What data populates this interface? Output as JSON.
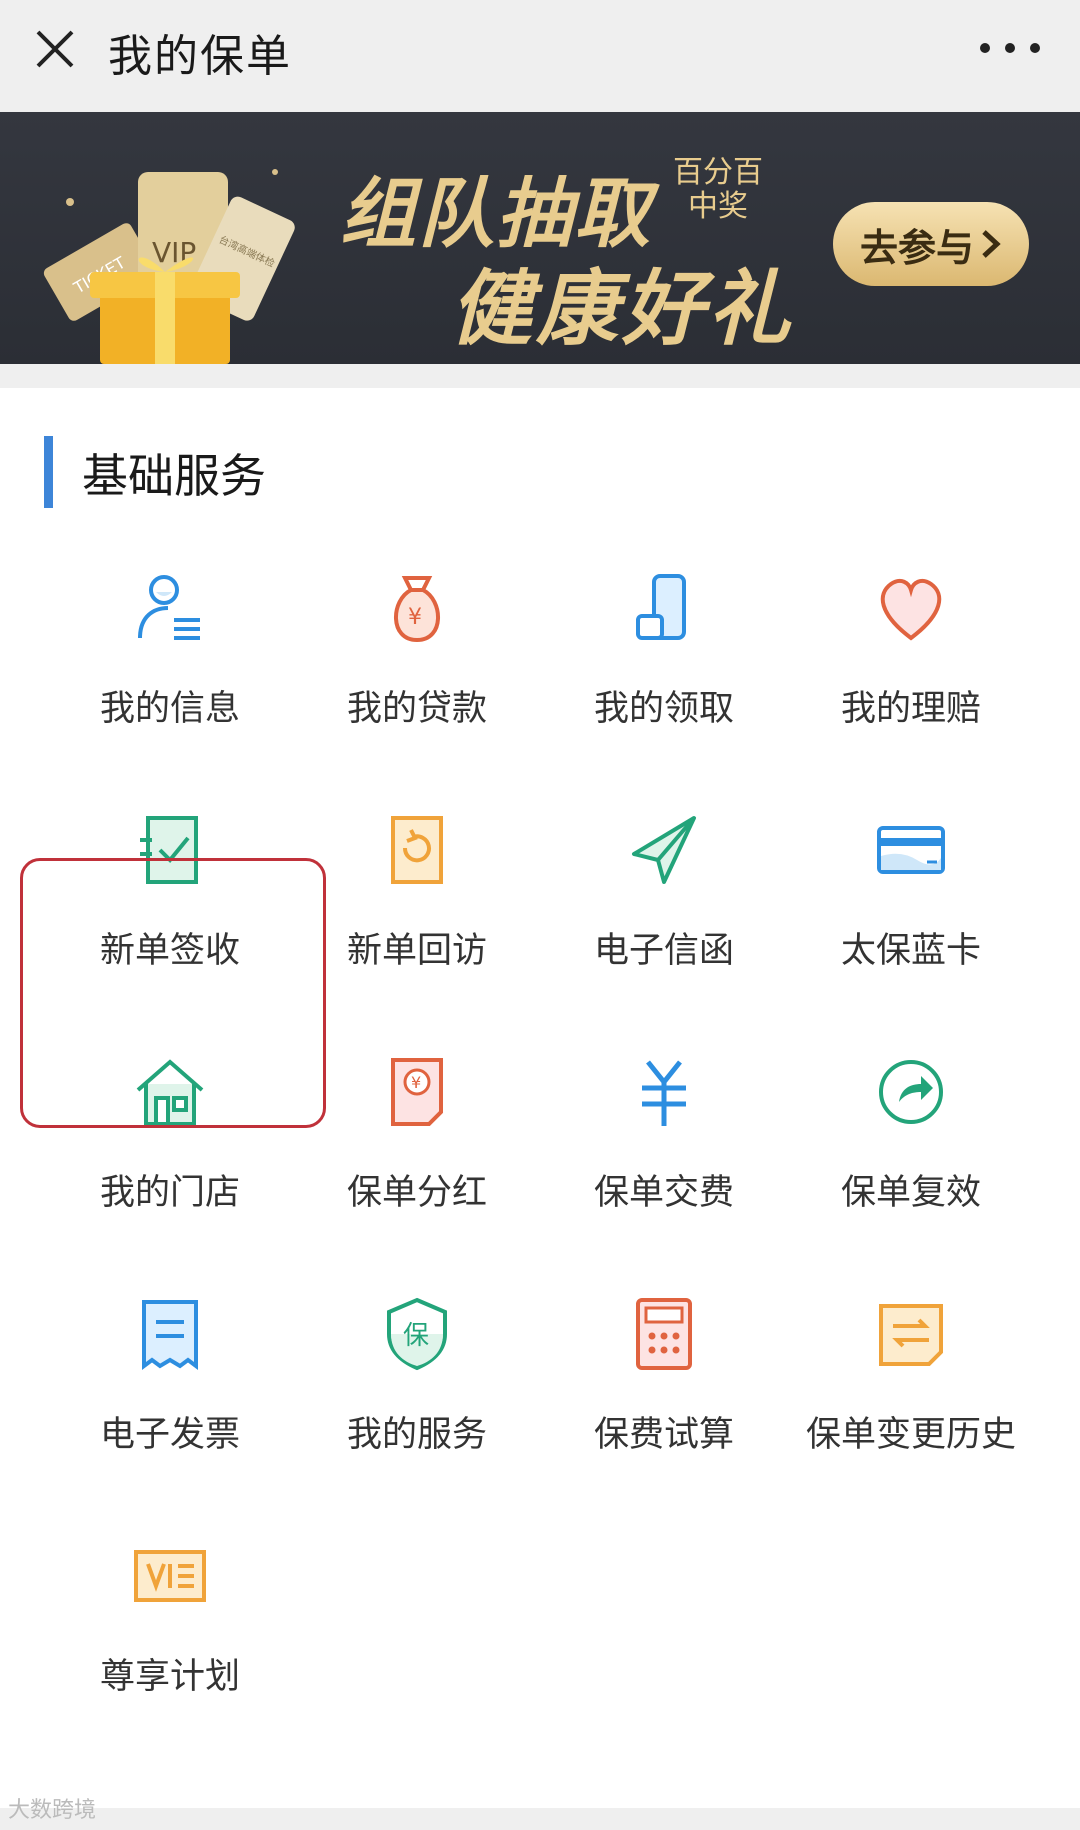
{
  "header": {
    "title": "我的保单",
    "close_icon": "close-icon",
    "more_icon": "more-icon"
  },
  "banner": {
    "line1": "组队抽取",
    "small_line1": "百分百",
    "small_line2": "中奖",
    "line2": "健康好礼",
    "button_label": "去参与",
    "art_vip": "VIP",
    "art_ticket": "TICKET",
    "art_card": "台湾高端体检"
  },
  "section": {
    "title": "基础服务",
    "accent": "#3d85d8"
  },
  "services": [
    {
      "label": "我的信息",
      "icon": "user-info-icon"
    },
    {
      "label": "我的贷款",
      "icon": "money-bag-icon"
    },
    {
      "label": "我的领取",
      "icon": "receive-icon"
    },
    {
      "label": "我的理赔",
      "icon": "heart-icon"
    },
    {
      "label": "新单签收",
      "icon": "sign-check-icon"
    },
    {
      "label": "新单回访",
      "icon": "revisit-icon"
    },
    {
      "label": "电子信函",
      "icon": "paper-plane-icon"
    },
    {
      "label": "太保蓝卡",
      "icon": "card-icon"
    },
    {
      "label": "我的门店",
      "icon": "house-icon"
    },
    {
      "label": "保单分红",
      "icon": "dividend-doc-icon"
    },
    {
      "label": "保单交费",
      "icon": "yuan-icon"
    },
    {
      "label": "保单复效",
      "icon": "share-arrow-icon"
    },
    {
      "label": "电子发票",
      "icon": "receipt-icon"
    },
    {
      "label": "我的服务",
      "icon": "shield-icon"
    },
    {
      "label": "保费试算",
      "icon": "calculator-icon"
    },
    {
      "label": "保单变更历史",
      "icon": "exchange-doc-icon"
    },
    {
      "label": "尊享计划",
      "icon": "vip-ticket-icon"
    }
  ],
  "watermark": "大数跨境"
}
